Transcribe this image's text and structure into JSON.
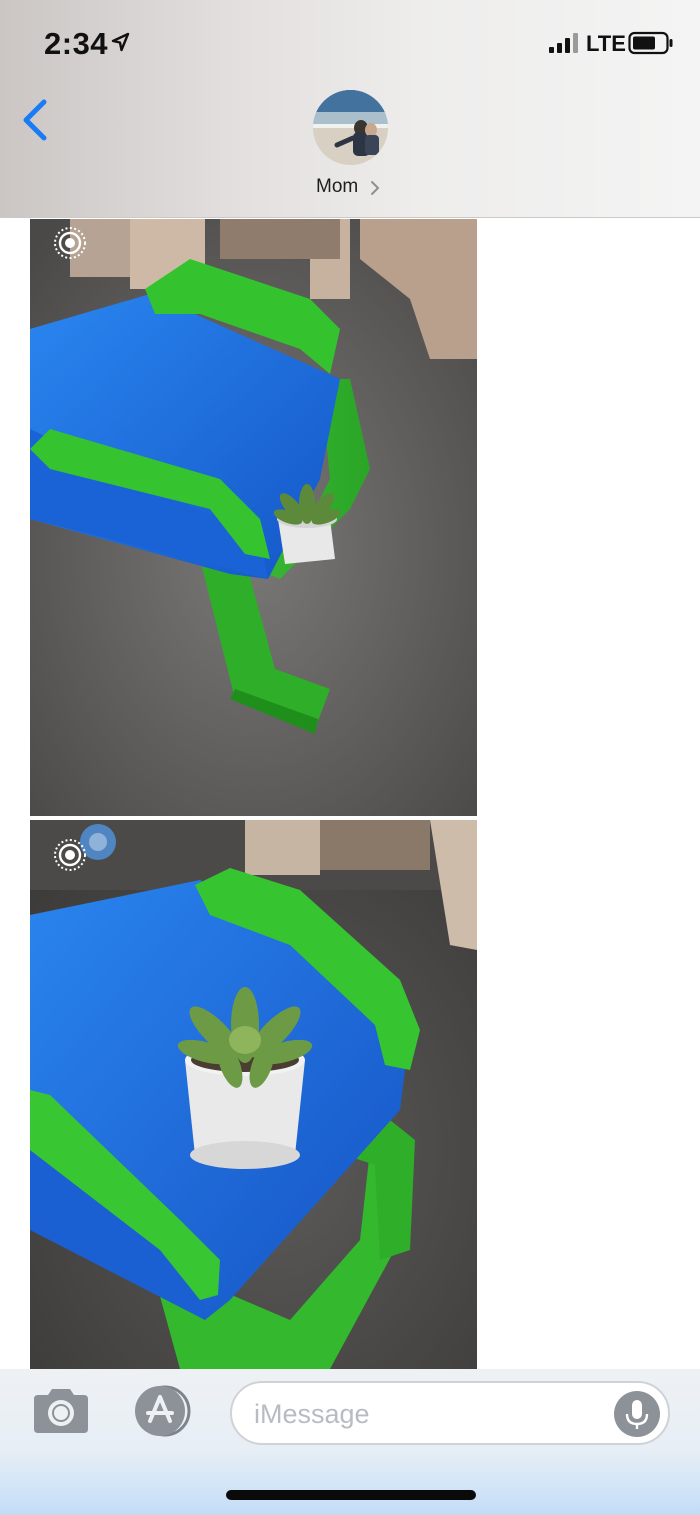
{
  "status_bar": {
    "time": "2:34",
    "network": "LTE",
    "location_icon": "location-arrow-icon",
    "signal_icon": "signal-bars-icon",
    "battery_icon": "battery-icon"
  },
  "header": {
    "contact_name": "Mom",
    "back_icon": "chevron-left-icon",
    "accent_color": "#1a7cf5"
  },
  "messages": [
    {
      "type": "live-photo",
      "badge_icon": "live-photo-icon"
    },
    {
      "type": "live-photo",
      "badge_icon": "live-photo-icon"
    }
  ],
  "compose": {
    "placeholder": "iMessage",
    "value": "",
    "camera_icon": "camera-icon",
    "apps_icon": "app-store-icon",
    "mic_icon": "microphone-icon"
  }
}
